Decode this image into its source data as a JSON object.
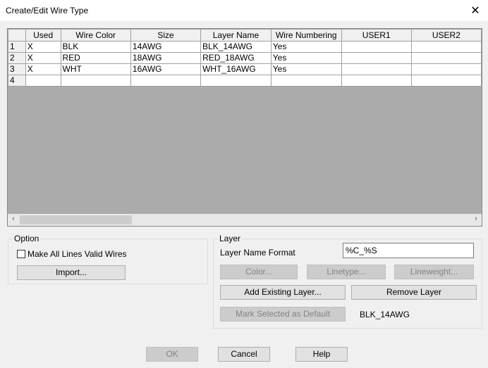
{
  "window": {
    "title": "Create/Edit Wire Type",
    "close_glyph": "✕"
  },
  "grid": {
    "columns": [
      "Used",
      "Wire Color",
      "Size",
      "Layer Name",
      "Wire Numbering",
      "USER1",
      "USER2"
    ],
    "rows": [
      {
        "num": "1",
        "cells": [
          "X",
          "BLK",
          "14AWG",
          "BLK_14AWG",
          "Yes",
          "",
          ""
        ]
      },
      {
        "num": "2",
        "cells": [
          "X",
          "RED",
          "18AWG",
          "RED_18AWG",
          "Yes",
          "",
          ""
        ]
      },
      {
        "num": "3",
        "cells": [
          "X",
          "WHT",
          "16AWG",
          "WHT_16AWG",
          "Yes",
          "",
          ""
        ]
      },
      {
        "num": "4",
        "cells": [
          "",
          "",
          "",
          "",
          "",
          "",
          ""
        ]
      }
    ]
  },
  "scrollbar": {
    "left_arrow": "‹",
    "right_arrow": "›"
  },
  "option": {
    "legend": "Option",
    "valid_wires_label": "Make All Lines Valid Wires",
    "valid_wires_checked": false,
    "import_label": "Import..."
  },
  "layer": {
    "legend": "Layer",
    "name_format_label": "Layer Name Format",
    "name_format_value": "%C_%S",
    "color_label": "Color...",
    "linetype_label": "Linetype...",
    "lineweight_label": "Lineweight...",
    "add_existing_label": "Add Existing Layer...",
    "remove_label": "Remove Layer",
    "mark_default_label": "Mark Selected as Default",
    "default_layer": "BLK_14AWG"
  },
  "footer": {
    "ok_label": "OK",
    "cancel_label": "Cancel",
    "help_label": "Help"
  }
}
